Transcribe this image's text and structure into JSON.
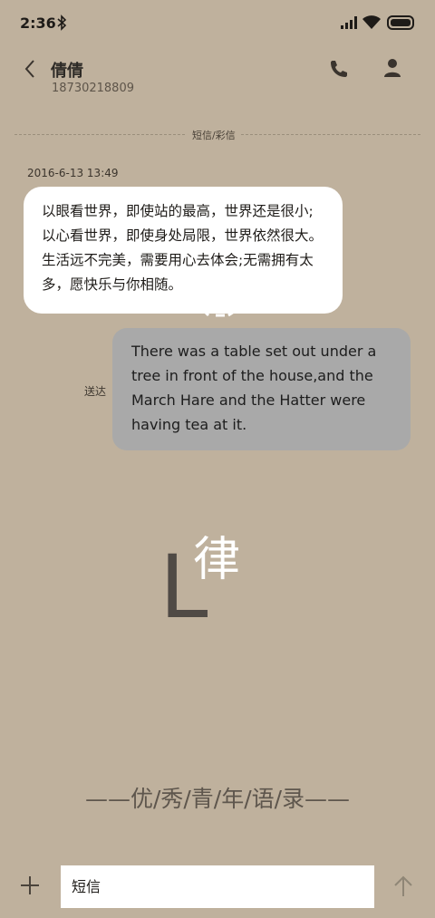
{
  "status_bar": {
    "time": "2:36",
    "icons": [
      "bluetooth-icon",
      "signal-icon",
      "wifi-icon",
      "battery-icon"
    ]
  },
  "header": {
    "contact_name": "倩倩",
    "phone_number": "18730218809"
  },
  "conversation": {
    "channel_label": "短信/彩信",
    "timestamp": "2016-6-13 13:49",
    "incoming_message": "以眼看世界，即使站的最高，世界还是很小;以心看世界，即使身处局限，世界依然很大。生活远不完美，需要用心去体会;无需拥有太多，愿快乐与你相随。",
    "outgoing_message": "There was a table set out under a tree in front of the house,and the March Hare and the Hatter were having tea at it.",
    "delivery_status": "送达"
  },
  "wallpaper": {
    "big_letter": "L",
    "calligraphy_char": "律",
    "quote": "——优/秀/青/年/语/录——"
  },
  "composer": {
    "placeholder": "短信"
  },
  "colors": {
    "background": "#bfb19d",
    "incoming_bubble": "#ffffff",
    "outgoing_bubble": "#a9a9a9"
  }
}
